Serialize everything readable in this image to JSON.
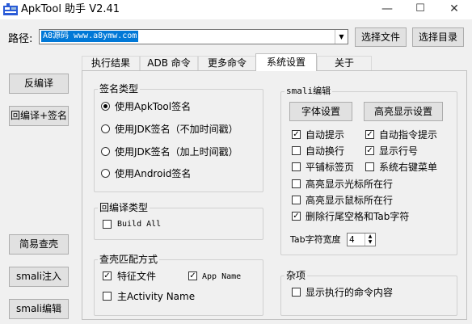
{
  "window": {
    "title": "ApkTool 助手 V2.41",
    "minimize": "—",
    "maximize": "☐",
    "close": "✕"
  },
  "path": {
    "label": "路径:",
    "value": "A8源码 www.a8ymw.com",
    "browse_file": "选择文件",
    "browse_dir": "选择目录"
  },
  "left_buttons": {
    "decompile": "反编译",
    "recompile_sign": "回编译+签名",
    "easy_check": "简易查壳",
    "smali_inject": "smali注入",
    "smali_edit": "smali编辑"
  },
  "tabs": [
    "执行结果",
    "ADB 命令",
    "更多命令",
    "系统设置",
    "关于"
  ],
  "active_tab": 3,
  "sign_type": {
    "title": "签名类型",
    "options": [
      {
        "label": "使用ApkTool签名",
        "selected": true
      },
      {
        "label": "使用JDK签名（不加时间戳）",
        "selected": false
      },
      {
        "label": "使用JDK签名（加上时间戳）",
        "selected": false
      },
      {
        "label": "使用Android签名",
        "selected": false
      }
    ]
  },
  "recompile_type": {
    "title": "回编译类型",
    "build_all": {
      "label": "Build All",
      "checked": false
    }
  },
  "shell_match": {
    "title": "查壳匹配方式",
    "feature_file": {
      "label": "特征文件",
      "checked": true
    },
    "app_name": {
      "label": "App Name",
      "checked": true
    },
    "main_activity": {
      "label": "主Activity Name",
      "checked": false
    }
  },
  "smali": {
    "title": "smali编辑",
    "font_button": "字体设置",
    "highlight_button": "高亮显示设置",
    "options": {
      "auto_hint": {
        "label": "自动提示",
        "checked": true
      },
      "auto_cmd_hint": {
        "label": "自动指令提示",
        "checked": true
      },
      "auto_wrap": {
        "label": "自动换行",
        "checked": false
      },
      "show_line_no": {
        "label": "显示行号",
        "checked": true
      },
      "flat_tabs": {
        "label": "平铺标签页",
        "checked": false
      },
      "right_menu": {
        "label": "系统右键菜单",
        "checked": false
      },
      "hl_cursor_line": {
        "label": "高亮显示光标所在行",
        "checked": false
      },
      "hl_mouse_line": {
        "label": "高亮显示鼠标所在行",
        "checked": false
      },
      "trim_trailing": {
        "label": "删除行尾空格和Tab字符",
        "checked": true
      }
    },
    "tab_width_label": "Tab字符宽度",
    "tab_width_value": "4"
  },
  "misc": {
    "title": "杂项",
    "show_cmd": {
      "label": "显示执行的命令内容",
      "checked": false
    }
  }
}
